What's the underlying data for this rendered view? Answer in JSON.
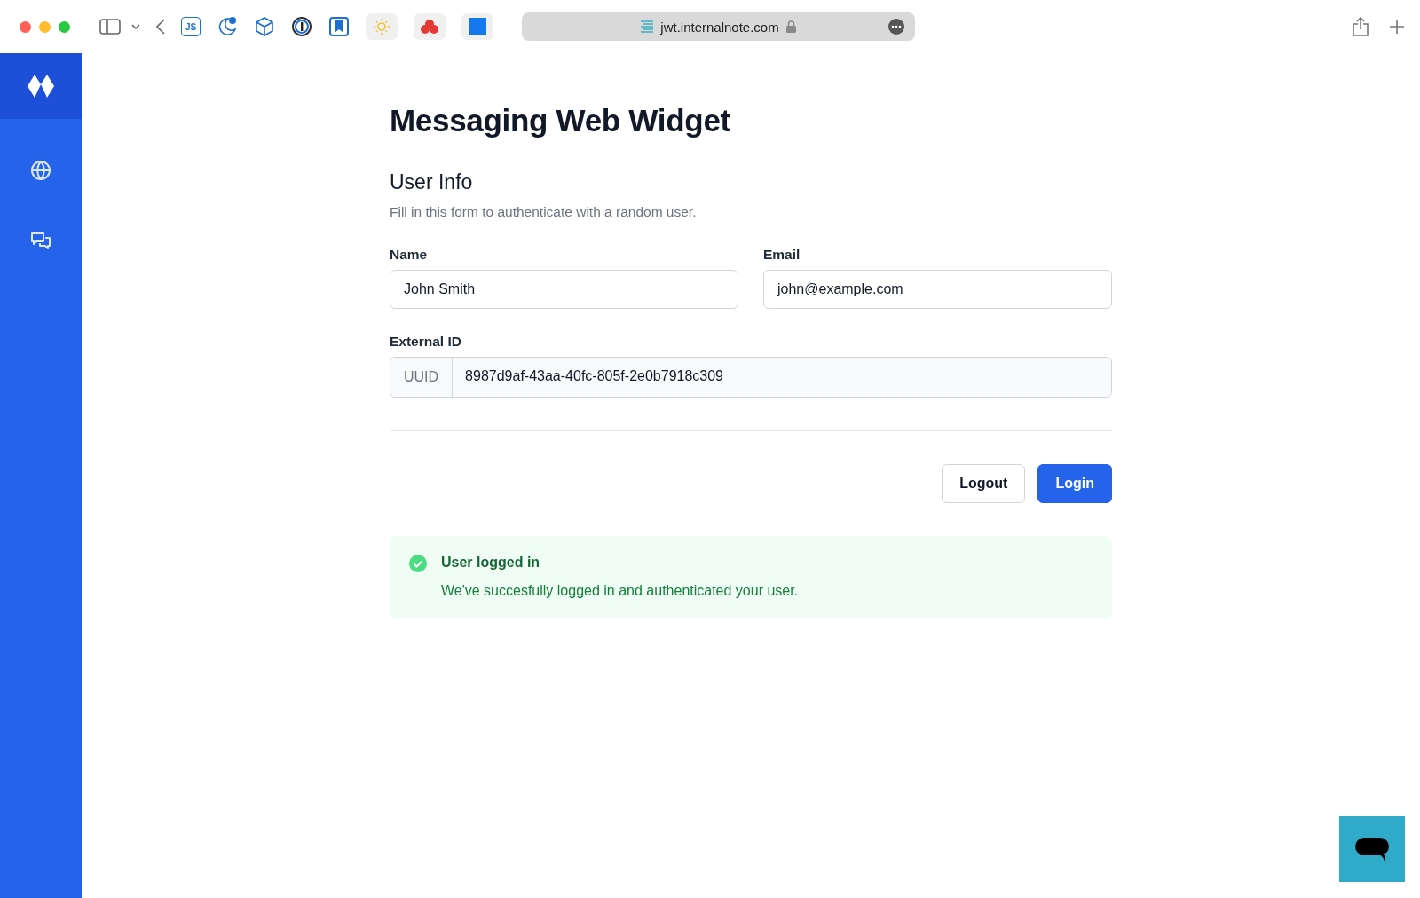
{
  "browser": {
    "js_badge": "JS",
    "address": "jwt.internalnote.com"
  },
  "page": {
    "title": "Messaging Web Widget",
    "section_title": "User Info",
    "description": "Fill in this form to authenticate with a random user.",
    "fields": [
      {
        "label": "Name",
        "value": "John Smith"
      },
      {
        "label": "Email",
        "value": "john@example.com"
      }
    ],
    "external_id": {
      "label": "External ID",
      "prefix": "UUID",
      "value": "8987d9af-43aa-40fc-805f-2e0b7918c309"
    },
    "buttons": [
      {
        "label": "Logout",
        "kind": "secondary"
      },
      {
        "label": "Login",
        "kind": "primary"
      }
    ],
    "alert": {
      "kind": "success",
      "title": "User logged in",
      "message": "We've succesfully logged in and authenticated your user."
    }
  }
}
